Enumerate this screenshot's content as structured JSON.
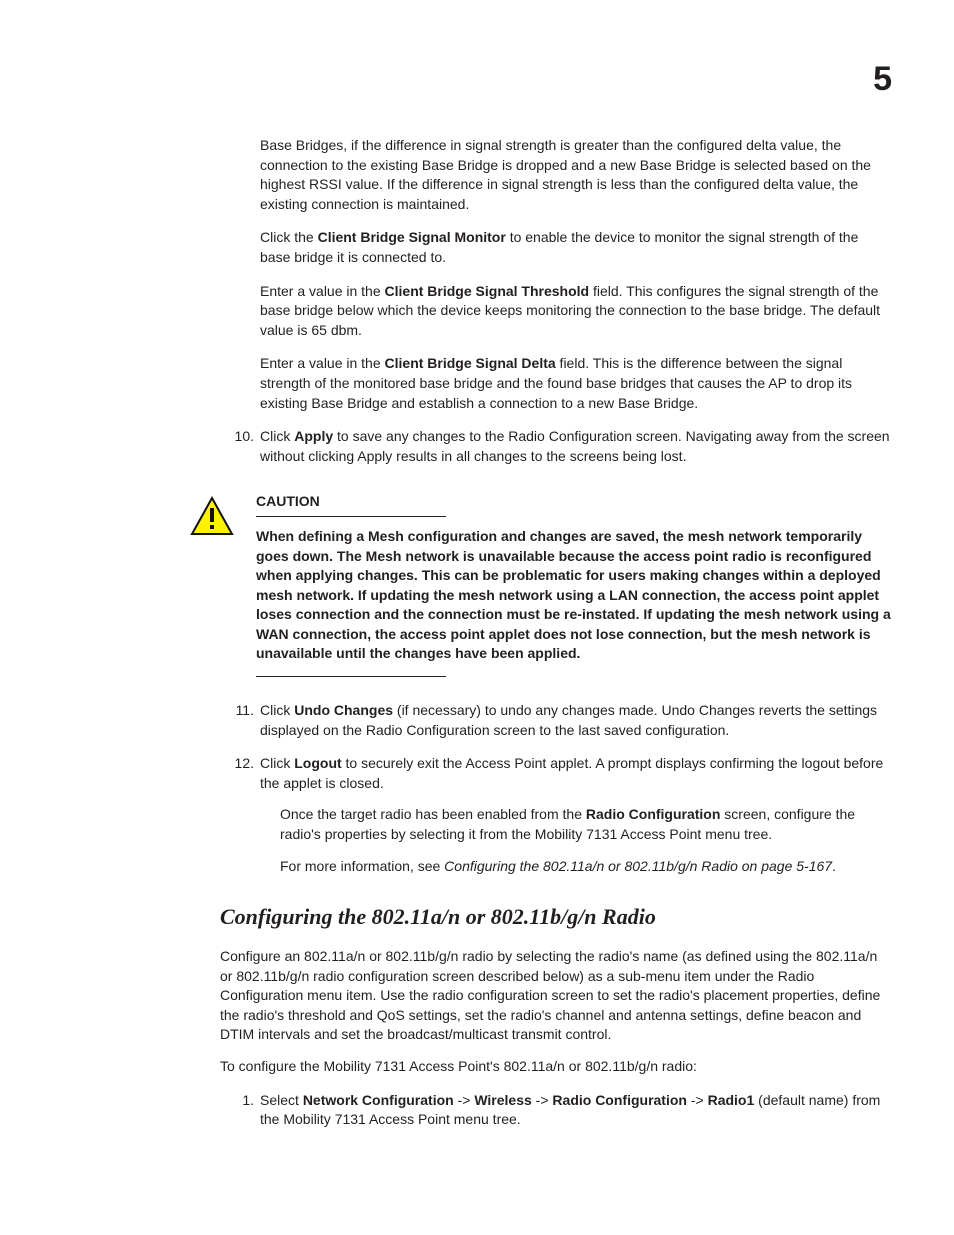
{
  "chapter_number": "5",
  "para_intro": {
    "pre": "Base Bridges, if the difference in signal strength is greater than the configured delta value, the connection to the existing Base Bridge is dropped and a new Base Bridge is selected based on the highest RSSI value. If the difference in signal strength is less than the configured delta value, the existing connection is maintained."
  },
  "para_monitor": {
    "pre": "Click the ",
    "b1": "Client Bridge Signal Monitor",
    "post": " to enable the device to monitor the signal strength of the base bridge it is connected to."
  },
  "para_threshold": {
    "pre": "Enter a value in the ",
    "b1": "Client Bridge Signal Threshold",
    "post": " field. This configures the signal strength of the base bridge below which the device keeps monitoring the connection to the base bridge. The default value is 65 dbm."
  },
  "para_delta": {
    "pre": "Enter a value in the ",
    "b1": "Client Bridge Signal Delta",
    "post": " field. This is the difference between the signal strength of the monitored base bridge and the found base bridges that causes the AP to drop its existing Base Bridge and establish a connection to a new Base Bridge."
  },
  "step10": {
    "num": "10.",
    "pre": "Click ",
    "b1": "Apply",
    "post": " to save any changes to the Radio Configuration screen. Navigating away from the screen without clicking Apply results in all changes to the screens being lost."
  },
  "caution": {
    "label": "CAUTION",
    "text": "When defining a Mesh configuration and changes are saved, the mesh network temporarily goes down. The Mesh network is unavailable because the access point radio is reconfigured when applying changes. This can be problematic for users making changes within a deployed mesh network. If updating the mesh network using a LAN connection, the access point applet loses connection and the connection must be re-instated. If updating the mesh network using a WAN connection, the access point applet does not lose connection, but the mesh network is unavailable until the changes have been applied."
  },
  "step11": {
    "num": "11.",
    "pre": "Click ",
    "b1": "Undo Changes",
    "post": " (if necessary) to undo any changes made. Undo Changes reverts the settings displayed on the Radio Configuration screen to the last saved configuration."
  },
  "step12": {
    "num": "12.",
    "pre": "Click ",
    "b1": "Logout",
    "post": " to securely exit the Access Point applet. A prompt displays confirming the logout before the applet is closed.",
    "sub1_pre": "Once the target radio has been enabled from the ",
    "sub1_b": "Radio Configuration",
    "sub1_post": " screen, configure the radio's properties by selecting it from the Mobility 7131 Access Point menu tree.",
    "sub2_pre": "For more information, see ",
    "sub2_i": "Configuring the 802.11a/n or 802.11b/g/n Radio on page 5-167",
    "sub2_post": "."
  },
  "section": {
    "heading": "Configuring the 802.11a/n or 802.11b/g/n Radio",
    "para1": "Configure an 802.11a/n or 802.11b/g/n radio by selecting the radio's name (as defined using the 802.11a/n or 802.11b/g/n radio configuration screen described below) as a sub-menu item under the Radio Configuration menu item. Use the radio configuration screen to set the radio's placement properties, define the radio's threshold and QoS settings, set the radio's channel and antenna settings, define beacon and DTIM intervals and set the broadcast/multicast transmit control.",
    "para2": "To configure the Mobility 7131 Access Point's 802.11a/n or 802.11b/g/n radio:",
    "step1_num": "1.",
    "step1_pre": "Select ",
    "step1_b1": "Network Configuration",
    "step1_sep1": " -> ",
    "step1_b2": "Wireless",
    "step1_sep2": " -> ",
    "step1_b3": "Radio Configuration",
    "step1_sep3": " -> ",
    "step1_b4": "Radio1",
    "step1_post": " (default name) from the Mobility 7131 Access Point menu tree."
  }
}
